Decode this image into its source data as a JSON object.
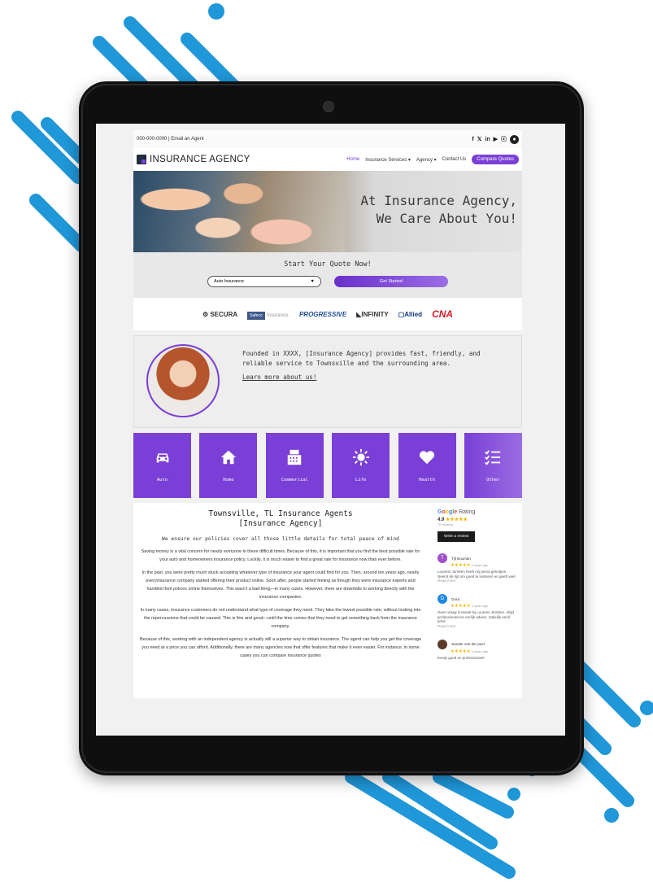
{
  "colors": {
    "accent": "#7a3fd6",
    "deco": "#1f97d8",
    "bezel": "#0f0f10"
  },
  "topbar": {
    "contact": "000-000-0000 | Email an Agent",
    "social": [
      "f",
      "𝕏",
      "in",
      "▶",
      "ⓩ"
    ],
    "account_icon": "user-icon"
  },
  "nav": {
    "logo": "INSURANCE AGENCY",
    "items": [
      "Home",
      "Insurance Services ▾",
      "Agency ▾",
      "Contact Us"
    ],
    "cta": "Compare Quotes"
  },
  "hero": {
    "line1": "At Insurance Agency,",
    "line2": "We Care About You!"
  },
  "quote": {
    "title": "Start Your Quote Now!",
    "select_value": "Auto Insurance",
    "button": "Get Started"
  },
  "carriers": {
    "secura": "SECURA",
    "safeco": "Safeco",
    "safeco_b": "Insurance.",
    "progressive": "PROGRESSIVE",
    "infinity": "INFINITY",
    "allied": "Allied",
    "cna": "CNA"
  },
  "about": {
    "text": "Founded in XXXX, [Insurance Agency] provides fast, friendly, and reliable service to Townsville and the surrounding area.",
    "link": "Learn more about us!"
  },
  "tiles": [
    {
      "label": "Auto",
      "icon": "car-icon"
    },
    {
      "label": "Home",
      "icon": "house-icon"
    },
    {
      "label": "Commercial",
      "icon": "register-icon"
    },
    {
      "label": "Life",
      "icon": "sun-icon"
    },
    {
      "label": "Health",
      "icon": "heart-icon"
    },
    {
      "label": "Other",
      "icon": "checklist-icon"
    }
  ],
  "content": {
    "title1": "Townsville, TL Insurance Agents",
    "title2": "[Insurance Agency]",
    "subtitle": "We ensure our policies cover all those little details for total peace of mind",
    "p1": "Saving money is a vital concern for nearly everyone in these difficult times. Because of this, it is important that you find the best possible rate for your auto and homeowners insurance policy. Luckily, it is much easier to find a great rate for insurance now than ever before.",
    "p2": "In the past, you were pretty much stuck accepting whatever type of insurance your agent could find for you. Then, around ten years ago, nearly everyinsurance company started offering their product online. Soon after, people started feeling as though they were insurance experts and handled their polices online themselves. This wasn't a bad thing—in many cases. However, there are downfalls to working directly with the insurance companies.",
    "p3": "In many cases, insurance customers do not understand what type of coverage they need. They take the lowest possible rate, without looking into the repercussions that could be caused. This is fine and good—until the time comes that they need to get something back from the insurance company.",
    "p4": "Because of this, working with an independent agency is actually still a superior way to obtain insurance. The agent can help you get the coverage you need at a price you can afford. Additionally, there are many agencies now that offer features that make it even easier. For instance, in some cases you can compare insurance quotes"
  },
  "google": {
    "label": "Rating",
    "score": "4.9",
    "stars": "★★★★★",
    "reviews": "70 reviews",
    "write_button": "Write a review"
  },
  "reviews": [
    {
      "initial": "T",
      "name": "Tijl Bouman",
      "stars": "★★★★★",
      "time": "3 years ago",
      "text": "Lourens Jurriëen heeft mij prima geholpen. Neemt de tijd om goed te luisteren en geeft veel",
      "more": "Read more"
    },
    {
      "initial": "D",
      "name": "Dora",
      "stars": "★★★★★",
      "time": "3 years ago",
      "text": "Geen vraag is teveel bij Lourens Jurriëen. Altijd professioneel en eerlijk advies. Zakelijk en/of privé",
      "more": "Read more"
    },
    {
      "initial": "",
      "name": "Sander van der poel",
      "stars": "★★★★★",
      "time": "3 years ago",
      "text": "Erwijs goed en professioneel",
      "more": ""
    }
  ]
}
